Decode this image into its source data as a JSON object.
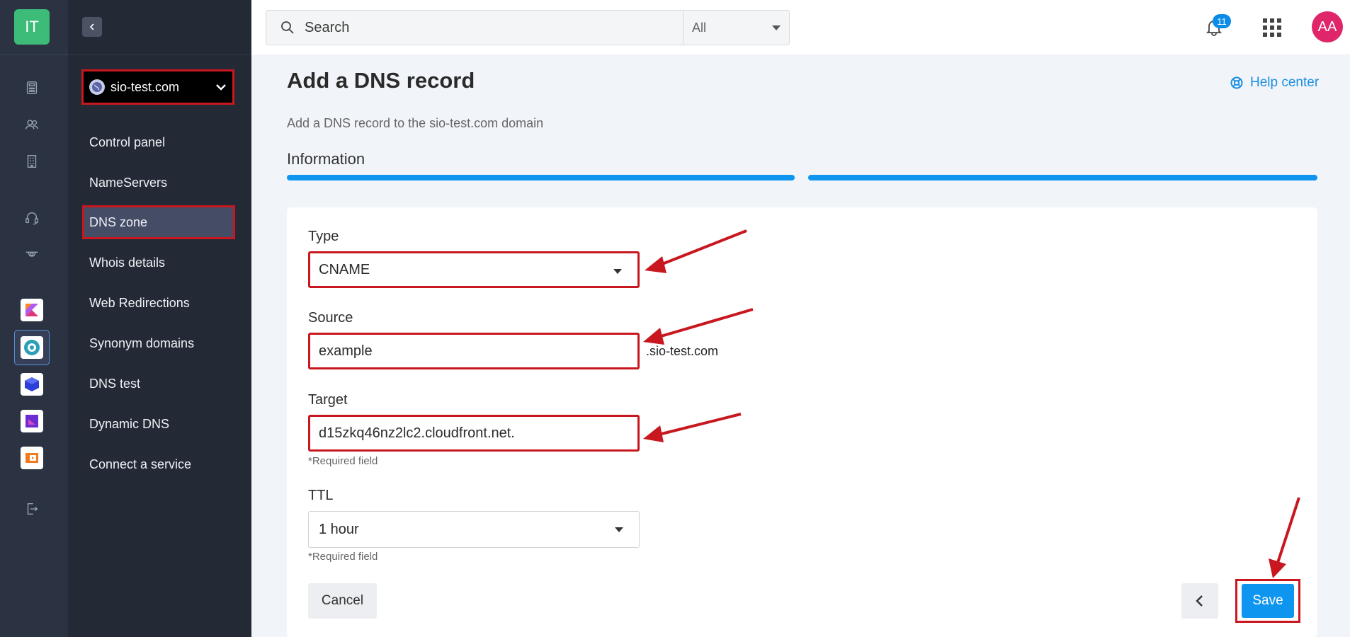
{
  "brand": {
    "logo_text": "IT",
    "accent": "#3dbb79",
    "highlight": "#c8171e",
    "primary": "#0e95ef"
  },
  "rail": {
    "icons": [
      "calculator-icon",
      "users-icon",
      "building-icon",
      "headset-icon",
      "badge-icon"
    ],
    "apps": [
      "kotlin-app-icon",
      "domain-app-icon",
      "cube-app-icon",
      "media-app-icon",
      "slides-app-icon"
    ],
    "logout_icon": "logout-icon"
  },
  "nav": {
    "domain": "sio-test.com",
    "items": [
      {
        "label": "Control panel"
      },
      {
        "label": "NameServers"
      },
      {
        "label": "DNS zone",
        "active": true
      },
      {
        "label": "Whois details"
      },
      {
        "label": "Web Redirections"
      },
      {
        "label": "Synonym domains"
      },
      {
        "label": "DNS test"
      },
      {
        "label": "Dynamic DNS"
      },
      {
        "label": "Connect a service"
      }
    ]
  },
  "topbar": {
    "search_placeholder": "Search",
    "scope": "All",
    "notifications": "11",
    "avatar": "AA"
  },
  "page": {
    "title": "Add a DNS record",
    "help": "Help center",
    "subtitle": "Add a DNS record to the sio-test.com domain",
    "section": "Information"
  },
  "form": {
    "type_label": "Type",
    "type_value": "CNAME",
    "source_label": "Source",
    "source_value": "example",
    "source_suffix": ".sio-test.com",
    "target_label": "Target",
    "target_value": "d15zkq46nz2lc2.cloudfront.net.",
    "required_note": "*Required field",
    "ttl_label": "TTL",
    "ttl_value": "1 hour",
    "cancel": "Cancel",
    "save": "Save"
  }
}
